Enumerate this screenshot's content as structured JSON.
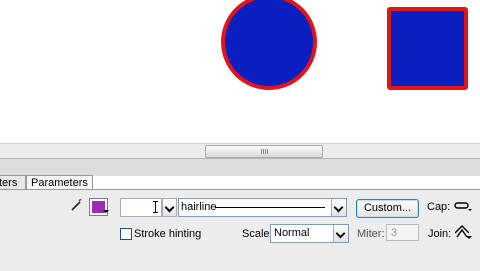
{
  "panel": {
    "tabs": [
      {
        "label": "ters"
      },
      {
        "label": "Parameters"
      }
    ]
  },
  "stroke": {
    "color": "#9e2bb5",
    "height_value": "",
    "style_label": "hairline",
    "custom_label": "Custom...",
    "cap_label": "Cap:",
    "hinting_label": "Stroke hinting",
    "scale_label": "Scale:",
    "scale_value": "Normal",
    "miter_label": "Miter:",
    "miter_value": "3",
    "join_label": "Join:"
  },
  "stage": {
    "shape_fill": "#0a1fbf",
    "shape_stroke": "#e1141b"
  }
}
